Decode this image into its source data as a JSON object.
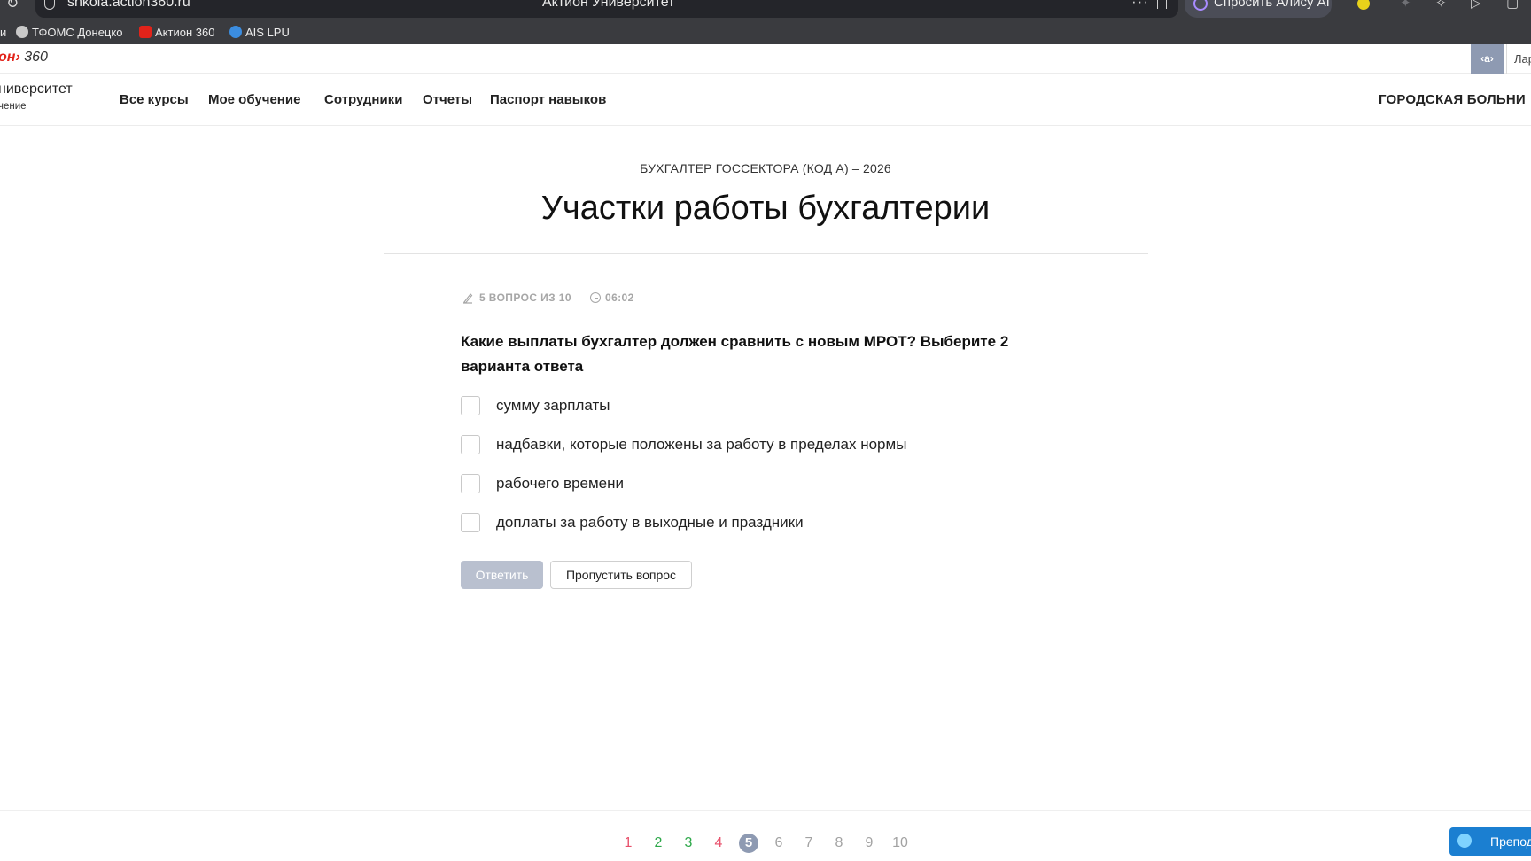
{
  "browser": {
    "url": "shkola.action360.ru",
    "tab_title": "Актион Университет",
    "alice_label": "Спросить Алису AI",
    "bookmarks_cut": "и",
    "bookmarks": [
      "ТФОМС Донецко",
      "Актион 360",
      "AIS LPU"
    ]
  },
  "site": {
    "brand_a": "он",
    "brand_b": "360",
    "help_label": "‹a›",
    "user_name": "Лар",
    "logo_name": "ниверситет",
    "logo_sub": "чение",
    "nav": [
      "Все курсы",
      "Мое обучение",
      "Сотрудники",
      "Отчеты",
      "Паспорт навыков"
    ],
    "org": "ГОРОДСКАЯ БОЛЬНИ"
  },
  "test": {
    "course": "БУХГАЛТЕР ГОССЕКТОРА (КОД А) – 2026",
    "title": "Участки работы бухгалтерии",
    "progress": "5 ВОПРОС ИЗ 10",
    "timer": "06:02",
    "question": "Какие выплаты бухгалтер должен сравнить с новым МРОТ? Выберите 2 варианта ответа",
    "options": [
      {
        "label": "сумму зарплаты",
        "checked": false
      },
      {
        "label": "надбавки, которые положены за работу в пределах нормы",
        "checked": false
      },
      {
        "label": "рабочего времени",
        "checked": false
      },
      {
        "label": "доплаты за работу в выходные и праздники",
        "checked": false
      }
    ],
    "answer_label": "Ответить",
    "skip_label": "Пропустить вопрос"
  },
  "pagination": {
    "current": 5,
    "pages": [
      {
        "n": "1",
        "color": "#e8506b"
      },
      {
        "n": "2",
        "color": "#2ea84a"
      },
      {
        "n": "3",
        "color": "#2ea84a"
      },
      {
        "n": "4",
        "color": "#e8506b"
      },
      {
        "n": "5",
        "color": "#ffffff"
      },
      {
        "n": "6",
        "color": "#a2a2a2"
      },
      {
        "n": "7",
        "color": "#a2a2a2"
      },
      {
        "n": "8",
        "color": "#a2a2a2"
      },
      {
        "n": "9",
        "color": "#a2a2a2"
      },
      {
        "n": "10",
        "color": "#a2a2a2"
      }
    ]
  },
  "chat": {
    "label": "Препод"
  },
  "colors": {
    "current_page_bg": "#8e9ab2",
    "answer_disabled": "#b9c0cf",
    "accent_red": "#e2231a"
  }
}
